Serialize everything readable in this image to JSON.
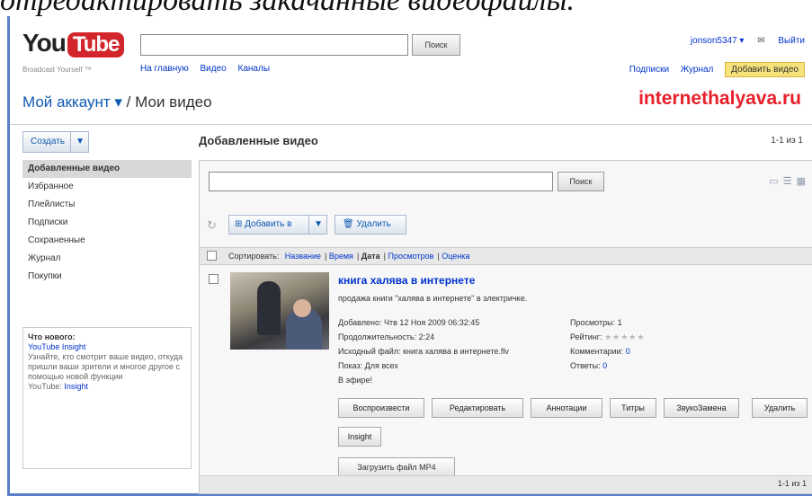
{
  "caption": "отредактировать закачанные видеофайлы.",
  "logo": {
    "you": "You",
    "tube": "Tube",
    "slogan": "Broadcast Yourself ™"
  },
  "search": {
    "button": "Поиск",
    "value": ""
  },
  "topnav": [
    "На главную",
    "Видео",
    "Каналы"
  ],
  "user": {
    "name": "jonson5347 ▾",
    "mail": "✉",
    "logout": "Выйти"
  },
  "rightnav": {
    "subs": "Подписки",
    "history": "Журнал",
    "upload": "Добавить видео"
  },
  "account": {
    "menu": "Мой аккаунт ▾",
    "sep": "/",
    "current": "Мои видео"
  },
  "watermark": "internethalyava.ru",
  "create": {
    "label": "Создать",
    "arrow": "▼"
  },
  "sidebar": [
    "Добавленные видео",
    "Избранное",
    "Плейлисты",
    "Подписки",
    "Сохраненные",
    "Журнал",
    "Покупки"
  ],
  "news": {
    "heading": "Что нового:",
    "link": "YouTube Insight",
    "text": "Узнайте, кто смотрит ваше видео, откуда пришли ваши зрители и многое другое с помощью новой функции",
    "footer_prefix": "YouTube:",
    "footer_link": "Insight"
  },
  "main": {
    "title": "Добавленные видео",
    "count": "1-1 из 1"
  },
  "inner_search": {
    "button": "Поиск",
    "value": ""
  },
  "toolbar": {
    "refresh": "↻",
    "add": "⊞ Добавить в",
    "add_arrow": "▼",
    "delete": "🗑 Удалить"
  },
  "sort": {
    "label": "Сортировать:",
    "items": [
      {
        "label": "Название",
        "selected": false
      },
      {
        "label": "Время",
        "selected": false
      },
      {
        "label": "Дата",
        "selected": true
      },
      {
        "label": "Просмотров",
        "selected": false
      },
      {
        "label": "Оценка",
        "selected": false
      }
    ]
  },
  "video": {
    "title": "книга халява в интернете",
    "desc": "продажа книги \"халява в интернете\" в электричке.",
    "added": "Добавлено: Чтв 12 Ноя 2009 06:32:45",
    "duration": "Продолжительность: 2:24",
    "source": "Исходный файл: книга халява в интернете.flv",
    "show": "Показ: Для всех",
    "live": "В эфире!",
    "views_label": "Просмотры:",
    "views": "1",
    "rating_label": "Рейтинг:",
    "stars": "★★★★★",
    "comments_label": "Комментарии:",
    "comments": "0",
    "replies_label": "Ответы:",
    "replies": "0"
  },
  "actions": [
    "Воспроизвести",
    "Редактировать",
    "Аннотации",
    "Титры",
    "ЗвукоЗамена",
    "Удалить"
  ],
  "insight": "Insight",
  "mp4": "Загрузить файл MP4",
  "bottom_count": "1-1 из 1",
  "colors": {
    "accent_red": "#e02020",
    "link_blue": "#0033cc",
    "frame_blue": "#5a7fc6"
  }
}
